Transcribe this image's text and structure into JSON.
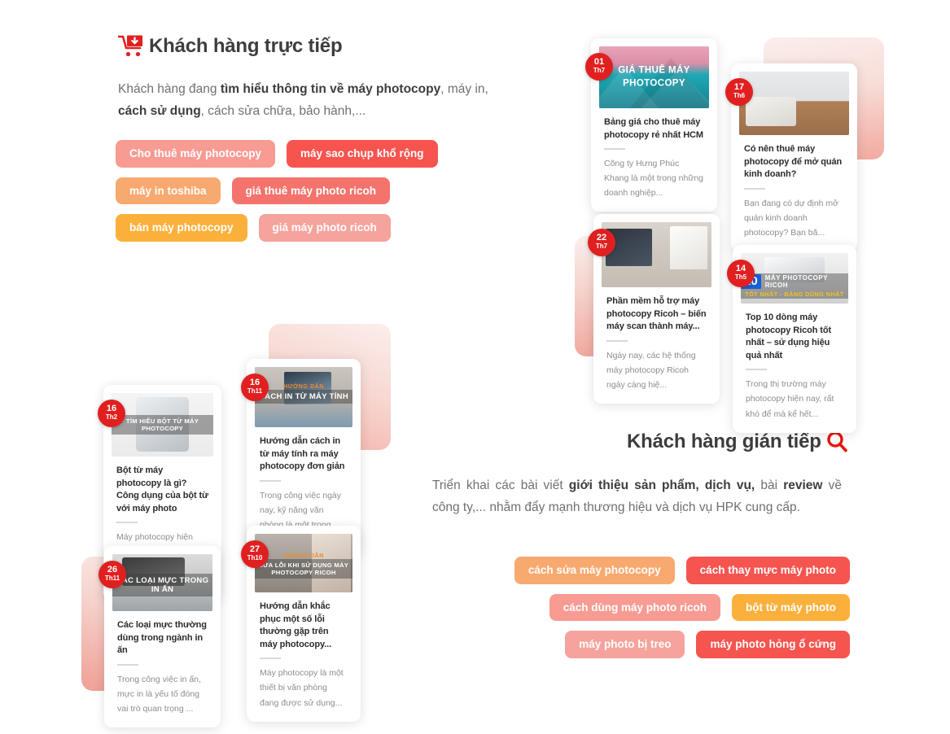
{
  "sections": {
    "direct": {
      "title": "Khách hàng trực tiếp",
      "icon": "cart-down-icon",
      "paragraph_html": "Khách hàng đang <b>tìm hiểu thông tin về máy photocopy</b>, máy in, <b>cách sử dụng</b>, cách sửa chữa, bảo hành,...",
      "tags": [
        {
          "label": "Cho thuê máy photocopy",
          "color": "#f79b93"
        },
        {
          "label": "máy sao chụp khổ rộng",
          "color": "#f7544f"
        },
        {
          "label": "máy in toshiba",
          "color": "#f8a96f"
        },
        {
          "label": "giá thuê máy photo ricoh",
          "color": "#f4736c"
        },
        {
          "label": "bán máy photocopy",
          "color": "#fbb03b"
        },
        {
          "label": "giá máy photo ricoh",
          "color": "#f5a39c"
        }
      ]
    },
    "indirect": {
      "title": "Khách hàng gián tiếp",
      "icon": "search-icon",
      "paragraph_html": "Triển khai các bài viết <b>giới thiệu sản phẩm, dịch vụ,</b> bài <b>review</b> về công ty,... nhằm đẩy mạnh thương hiệu và dịch vụ HPK cung cấp.",
      "tags": [
        {
          "label": "cách sửa máy photocopy",
          "color": "#f8a96f"
        },
        {
          "label": "cách thay mực máy photo",
          "color": "#f5544f"
        },
        {
          "label": "cách dùng máy photo ricoh",
          "color": "#f79b93"
        },
        {
          "label": "bột từ máy photo",
          "color": "#fbb03b"
        },
        {
          "label": "máy photo bị treo",
          "color": "#f5a39c"
        },
        {
          "label": "máy photo hỏng ổ cứng",
          "color": "#f5544f"
        }
      ]
    }
  },
  "cards": [
    {
      "id": "card-gia-thue-may-photocopy",
      "day": "01",
      "month": "Th7",
      "overlay_title": "GIÁ THUÊ MÁY PHOTOCOPY",
      "title": "Bảng giá cho thuê máy photocopy rẻ nhất HCM",
      "excerpt": "Công ty Hưng Phúc Khang là một trong những doanh nghiệp..."
    },
    {
      "id": "card-co-nen-thue-may-photocopy",
      "day": "17",
      "month": "Th6",
      "overlay_title": "",
      "title": "Có nên thuê máy photocopy để mở quán kinh doanh?",
      "excerpt": "Bạn đang có dự định mở quán kinh doanh photocopy? Bạn bă..."
    },
    {
      "id": "card-phan-mem-ho-tro-ricoh",
      "day": "22",
      "month": "Th7",
      "overlay_title": "",
      "title": "Phần mềm hỗ trợ máy photocopy Ricoh – biến máy scan thành máy...",
      "excerpt": "Ngày nay, các hệ thống máy photocopy Ricoh ngày càng hiệ..."
    },
    {
      "id": "card-top-10-ricoh",
      "day": "14",
      "month": "Th5",
      "overlay_number": "10",
      "overlay_line1": "MÁY PHOTOCOPY RICOH",
      "overlay_line2": "TỐT NHẤT - ĐÁNG DÙNG NHẤT",
      "title": "Top 10 dòng máy photocopy Ricoh tốt nhất – sử dụng hiệu quả nhất",
      "excerpt": "Trong thị trường máy photocopy hiện nay, rất khó để mà kể hết..."
    },
    {
      "id": "card-bot-tu-may-photocopy",
      "day": "16",
      "month": "Th2",
      "overlay_title": "TÌM HIỂU BỘT TỪ MÁY PHOTOCOPY",
      "title": "Bột từ máy photocopy là gì? Công dụng của bột từ với máy photo",
      "excerpt": "Máy photocopy hiện nay là một thiết bị văn phòng vô cùng cần thiết...."
    },
    {
      "id": "card-cach-in-tu-may-tinh",
      "day": "16",
      "month": "Th11",
      "overlay_sub": "HƯỚNG DẪN",
      "overlay_title": "CÁCH IN TỪ MÁY TÍNH",
      "title": "Hướng dẫn cách in từ máy tính ra máy photocopy đơn giản",
      "excerpt": "Trong công việc ngày nay, kỹ năng văn phòng là một trong những kỹ..."
    },
    {
      "id": "card-cac-loai-muc-in-an",
      "day": "26",
      "month": "Th11",
      "overlay_title": "CÁC LOẠI MỰC TRONG IN ẤN",
      "title": "Các loại mực thường dùng trong ngành in ấn",
      "excerpt": "Trong công việc in ấn, mực in là yếu tố đóng vai trò quan trọng ..."
    },
    {
      "id": "card-sua-loi-may-photocopy-ricoh",
      "day": "27",
      "month": "Th10",
      "overlay_sub": "HƯỚNG DẪN",
      "overlay_title": "SỬA LỖI KHI SỬ DỤNG MÁY PHOTOCOPY RICOH",
      "title": "Hướng dẫn khắc phục một số lỗi thường gặp trên máy photocopy...",
      "excerpt": "Máy photocopy là một thiết bị văn phòng đang được sử dụng..."
    }
  ],
  "colors": {
    "brand_red": "#e02020",
    "text_dark": "#3d3d3d",
    "text_muted": "#8d8d8d",
    "deco_pink": "#f2a99f"
  }
}
